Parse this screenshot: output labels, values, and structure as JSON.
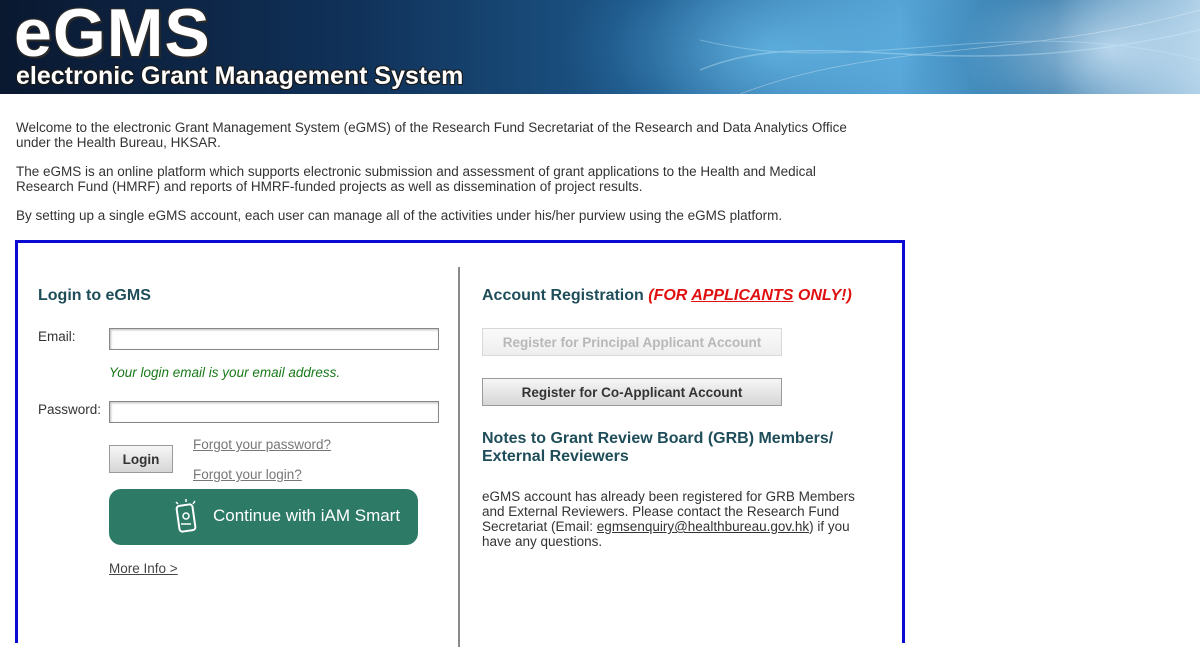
{
  "header": {
    "logo": "eGMS",
    "subtitle": "electronic Grant Management System"
  },
  "intro": {
    "paragraphs": [
      "Welcome to the electronic Grant Management System (eGMS) of the Research Fund Secretariat of the Research and Data Analytics Office under the Health Bureau, HKSAR.",
      "The eGMS is an online platform which supports electronic submission and assessment of grant applications to the Health and Medical Research Fund (HMRF) and reports of HMRF-funded projects as well as dissemination of project results.",
      "By setting up a single eGMS account, each user can manage all of the activities under his/her purview using the eGMS platform."
    ]
  },
  "login": {
    "title": "Login to eGMS",
    "email_label": "Email:",
    "email_value": "",
    "email_hint": "Your login email is your email address.",
    "password_label": "Password:",
    "password_value": "",
    "login_button": "Login",
    "forgot_password": "Forgot your password?",
    "forgot_login": "Forgot your login?",
    "iam_smart_button": "Continue with iAM Smart",
    "more_info": "More Info >"
  },
  "registration": {
    "title": "Account Registration",
    "note_prefix": "(FOR ",
    "note_emphasis": "APPLICANTS",
    "note_suffix": " ONLY!)",
    "principal_button": "Register for Principal Applicant Account",
    "co_applicant_button": "Register for Co-Applicant Account"
  },
  "notes": {
    "title_line1": "Notes to Grant Review Board (GRB) Members/",
    "title_line2": "External Reviewers",
    "body_before": "eGMS account has already been registered for GRB Members and External Reviewers. Please contact the Research Fund Secretariat (Email: ",
    "email": "egmsenquiry@healthbureau.gov.hk",
    "body_after": ") if you have any questions."
  },
  "colors": {
    "box_border": "#0a0ad2",
    "title": "#1f4e5a",
    "hint": "#1a7a1a",
    "note": "#e01010",
    "iam_button": "#2d7a66"
  }
}
